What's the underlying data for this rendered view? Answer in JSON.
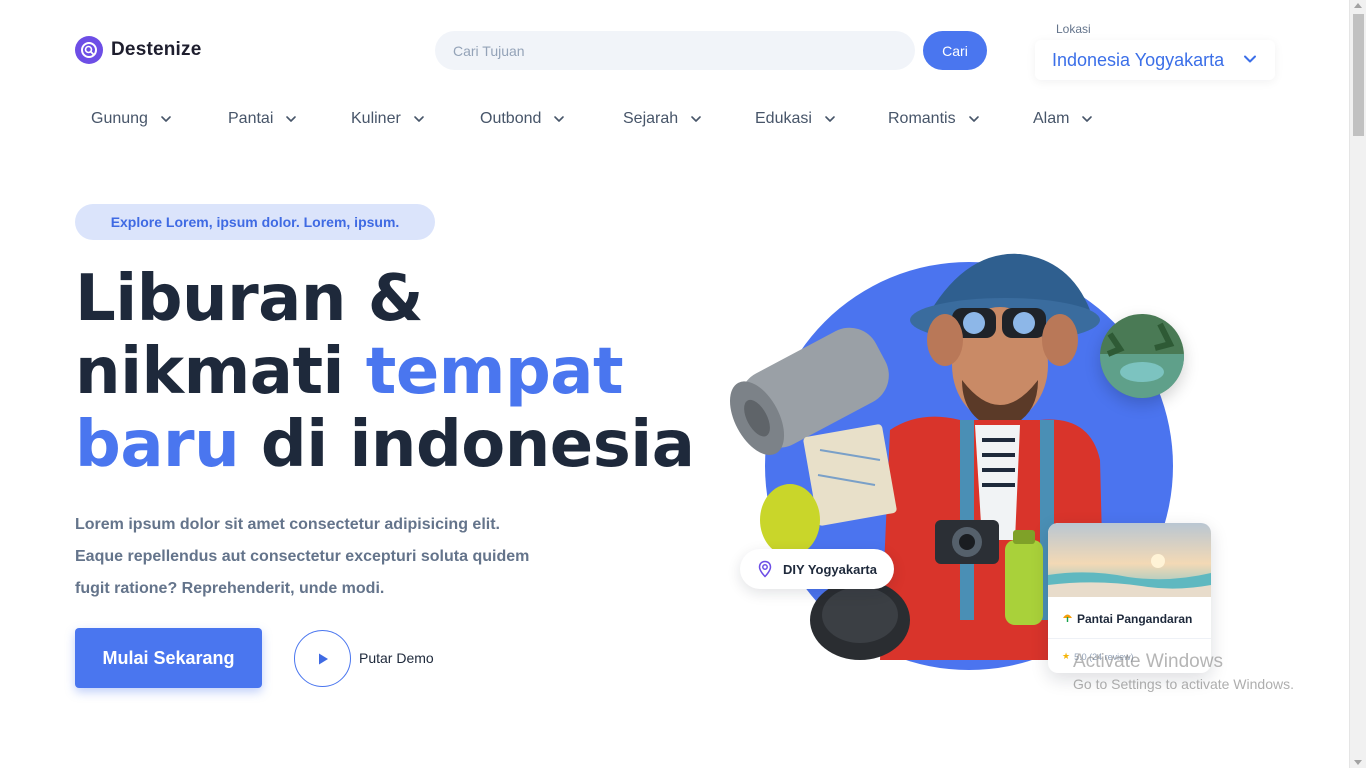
{
  "brand": {
    "name": "Destenize",
    "icon": "map-search-icon",
    "color": "#6d4ee6"
  },
  "search": {
    "placeholder": "Cari Tujuan",
    "button_label": "Cari"
  },
  "location": {
    "label": "Lokasi",
    "value": "Indonesia Yogyakarta",
    "icon": "chevron-down-icon"
  },
  "categories": [
    {
      "label": "Gunung"
    },
    {
      "label": "Pantai"
    },
    {
      "label": "Kuliner"
    },
    {
      "label": "Outbond"
    },
    {
      "label": "Sejarah"
    },
    {
      "label": "Edukasi"
    },
    {
      "label": "Romantis"
    },
    {
      "label": "Alam"
    }
  ],
  "hero": {
    "badge": "Explore Lorem, ipsum dolor. Lorem, ipsum.",
    "headline": {
      "line1": "Liburan &",
      "line2_a": "nikmati ",
      "line2_b": "tempat",
      "line3_a": "baru",
      "line3_b": " di indonesia"
    },
    "description": "Lorem ipsum dolor sit amet consectetur adipisicing elit. Eaque repellendus aut consectetur excepturi soluta quidem fugit ratione? Reprehenderit, unde modi.",
    "cta_label": "Mulai Sekarang",
    "demo_label": "Putar Demo"
  },
  "illustration": {
    "location_pill": "DIY Yogyakarta",
    "card_title": "Pantai Pangandaran",
    "card_rating": "5.0 (24 review)"
  },
  "watermark": {
    "title": "Activate Windows",
    "subtitle": "Go to Settings to activate Windows."
  },
  "colors": {
    "accent": "#4a76ef",
    "heading": "#1e293b",
    "muted": "#64748b",
    "badge_bg": "#dbe4fb"
  }
}
